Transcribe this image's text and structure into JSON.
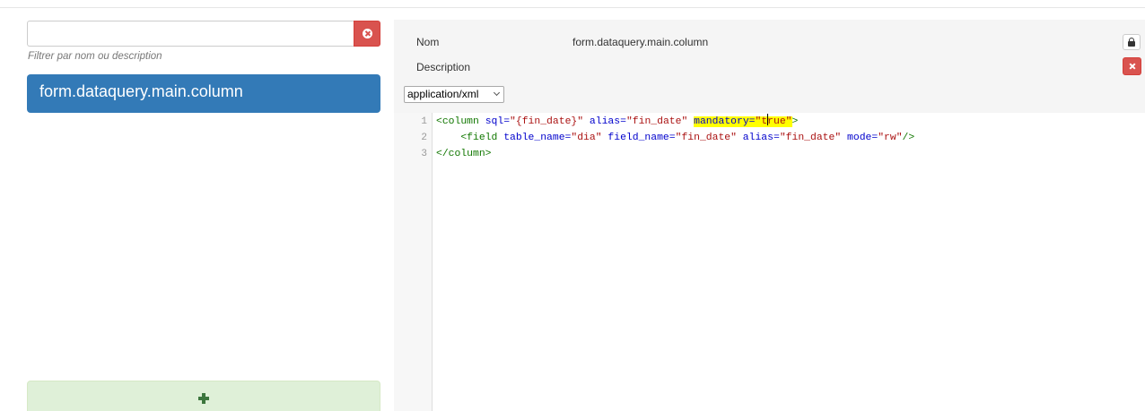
{
  "filter": {
    "value": "",
    "placeholder": "",
    "help": "Filtrer par nom ou description"
  },
  "list": {
    "items": [
      {
        "label": "form.dataquery.main.column",
        "selected": true
      }
    ]
  },
  "detail": {
    "name_label": "Nom",
    "name_value": "form.dataquery.main.column",
    "description_label": "Description",
    "description_value": "",
    "mime_type": "application/xml"
  },
  "editor": {
    "line_numbers": [
      "1",
      "2",
      "3"
    ],
    "line1": {
      "t1": "<column",
      "a1": " sql=",
      "s1": "\"{fin_date}\"",
      "a2": " alias=",
      "s2": "\"fin_date\"",
      "h_attr": "mandatory=",
      "h_str_a": "\"t",
      "h_str_b": "rue\"",
      "t2": ">"
    },
    "line2": {
      "indent": "    ",
      "t1": "<field",
      "a1": " table_name=",
      "s1": "\"dia\"",
      "a2": " field_name=",
      "s2": "\"fin_date\"",
      "a3": " alias=",
      "s3": "\"fin_date\"",
      "a4": " mode=",
      "s4": "\"rw\"",
      "t2": "/>"
    },
    "line3": {
      "t1": "</column>"
    }
  },
  "colors": {
    "primary": "#337ab7",
    "danger": "#d9534f",
    "success_bg": "#dff0d8",
    "success_icon": "#3c763d",
    "highlight": "#ffff00"
  },
  "icons": {
    "clear": "times-circle-icon",
    "lock": "lock-icon",
    "delete": "close-icon",
    "add": "plus-icon",
    "select": "chevron-down-icon"
  }
}
